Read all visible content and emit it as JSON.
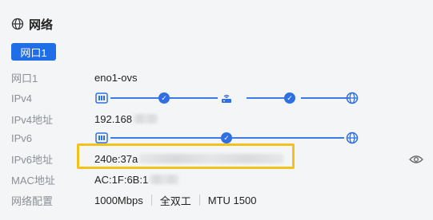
{
  "header": {
    "title": "网络"
  },
  "tabs": [
    {
      "label": "网口1"
    }
  ],
  "rows": {
    "port": {
      "label": "网口1",
      "value": "eno1-ovs"
    },
    "ipv4": {
      "label": "IPv4"
    },
    "ipv4_addr": {
      "label": "IPv4地址",
      "value": "192.168"
    },
    "ipv6": {
      "label": "IPv6"
    },
    "ipv6_addr": {
      "label": "IPv6地址",
      "value": "240e:37a"
    },
    "mac": {
      "label": "MAC地址",
      "value": "AC:1F:6B:1"
    },
    "config": {
      "label": "网络配置",
      "speed": "1000Mbps",
      "duplex": "全双工",
      "mtu": "MTU 1500"
    }
  },
  "colors": {
    "accent": "#1f6ee8",
    "highlight": "#f1c21b"
  },
  "icons": [
    "globe-icon",
    "network-card-icon",
    "router-icon",
    "check-circle-icon",
    "eye-icon"
  ]
}
